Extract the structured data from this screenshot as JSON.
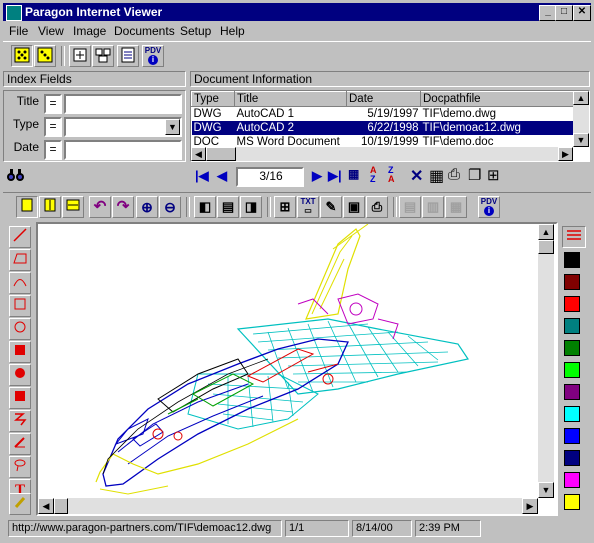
{
  "window": {
    "title": "Paragon Internet Viewer",
    "minimize": "_",
    "maximize": "□",
    "close": "✕"
  },
  "menu": [
    "File",
    "View",
    "Image",
    "Documents",
    "Setup",
    "Help"
  ],
  "index_fields": {
    "header": "Index Fields",
    "rows": [
      {
        "label": "Title",
        "op": "=",
        "value": ""
      },
      {
        "label": "Type",
        "op": "=",
        "value": ""
      },
      {
        "label": "Date",
        "op": "=",
        "value": ""
      }
    ]
  },
  "document_info": {
    "header": "Document Information",
    "columns": [
      "Type",
      "Title",
      "Date",
      "Docpathfile"
    ],
    "rows": [
      {
        "type": "DWG",
        "title": "AutoCAD 1",
        "date": "5/19/1997",
        "path": "TIF\\demo.dwg",
        "selected": false
      },
      {
        "type": "DWG",
        "title": "AutoCAD 2",
        "date": "6/22/1998",
        "path": "TIF\\demoac12.dwg",
        "selected": true
      },
      {
        "type": "DOC",
        "title": "MS Word Document",
        "date": "10/19/1999",
        "path": "TIF\\demo.doc",
        "selected": false
      }
    ]
  },
  "navigator": {
    "position": "3/16"
  },
  "toolbar_top": {
    "pdv_label": "PDV"
  },
  "toolbar_view": {
    "txt_label": "TXT",
    "pdv_label": "PDV"
  },
  "palette_colors": [
    "#000000",
    "#800000",
    "#ff0000",
    "#008080",
    "#008000",
    "#00ff00",
    "#800080",
    "#00ffff",
    "#0000ff",
    "#000080",
    "#ff00ff",
    "#ffff00"
  ],
  "status": {
    "url": "http://www.paragon-partners.com/TIF\\demoac12.dwg",
    "page": "1/1",
    "date": "8/14/00",
    "time": "2:39 PM"
  }
}
